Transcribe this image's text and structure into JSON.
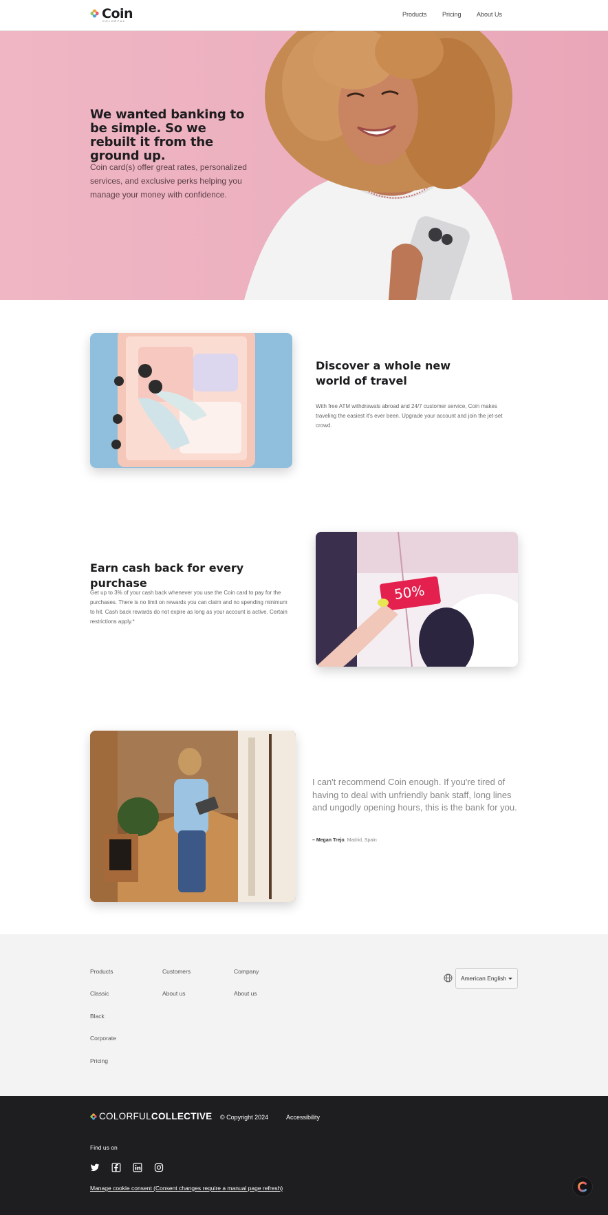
{
  "header": {
    "logo": {
      "name": "Coin",
      "sub": "COLORFUL"
    },
    "nav": [
      {
        "label": "Products"
      },
      {
        "label": "Pricing"
      },
      {
        "label": "About Us"
      }
    ]
  },
  "hero": {
    "title": "We wanted banking to be simple. So we rebuilt it from the ground up.",
    "body": "Coin card(s) offer great rates, personalized services, and exclusive perks helping you manage your money with confidence."
  },
  "features": [
    {
      "title": "Discover a whole new world of travel",
      "body": "With free ATM withdrawals abroad and 24/7 customer service, Coin makes traveling the easiest it's ever been. Upgrade your account and join the jet-set crowd."
    },
    {
      "title": "Earn cash back for every purchase",
      "body": "Get up to 3% of your cash back whenever you use the Coin card to pay for the purchases. There is no limit on rewards you can claim and no spending minimum to hit. Cash back rewards do not expire as long as your account is active. Certain restrictions apply.*",
      "tag_text": "50%"
    }
  ],
  "testimonial": {
    "quote": "I can't recommend Coin enough. If you're tired of having to deal with unfriendly bank staff, long lines and ungodly opening hours, this is the bank for you.",
    "author": "– Megan Trejo",
    "location": ", Madrid, Spain"
  },
  "footer": {
    "columns": [
      {
        "heading": "Products",
        "links": [
          "Classic",
          "Black",
          "Corporate",
          "Pricing"
        ]
      },
      {
        "heading": "Customers",
        "links": [
          "About us"
        ]
      },
      {
        "heading": "Company",
        "links": [
          "About us"
        ]
      }
    ],
    "language": "American English",
    "brand_light": "COLORFUL",
    "brand_bold": "COLLECTIVE",
    "copyright": "© Copyright 2024",
    "accessibility": "Accessibility",
    "find_us": "Find us on",
    "cookie": "Manage cookie consent (Consent changes require a manual page refresh)"
  },
  "colors": {
    "hero_bg": "#ecb0bf",
    "footer_light_bg": "#f3f3f3",
    "footer_dark_bg": "#1e1e20",
    "text_dark": "#1d1d1f"
  }
}
